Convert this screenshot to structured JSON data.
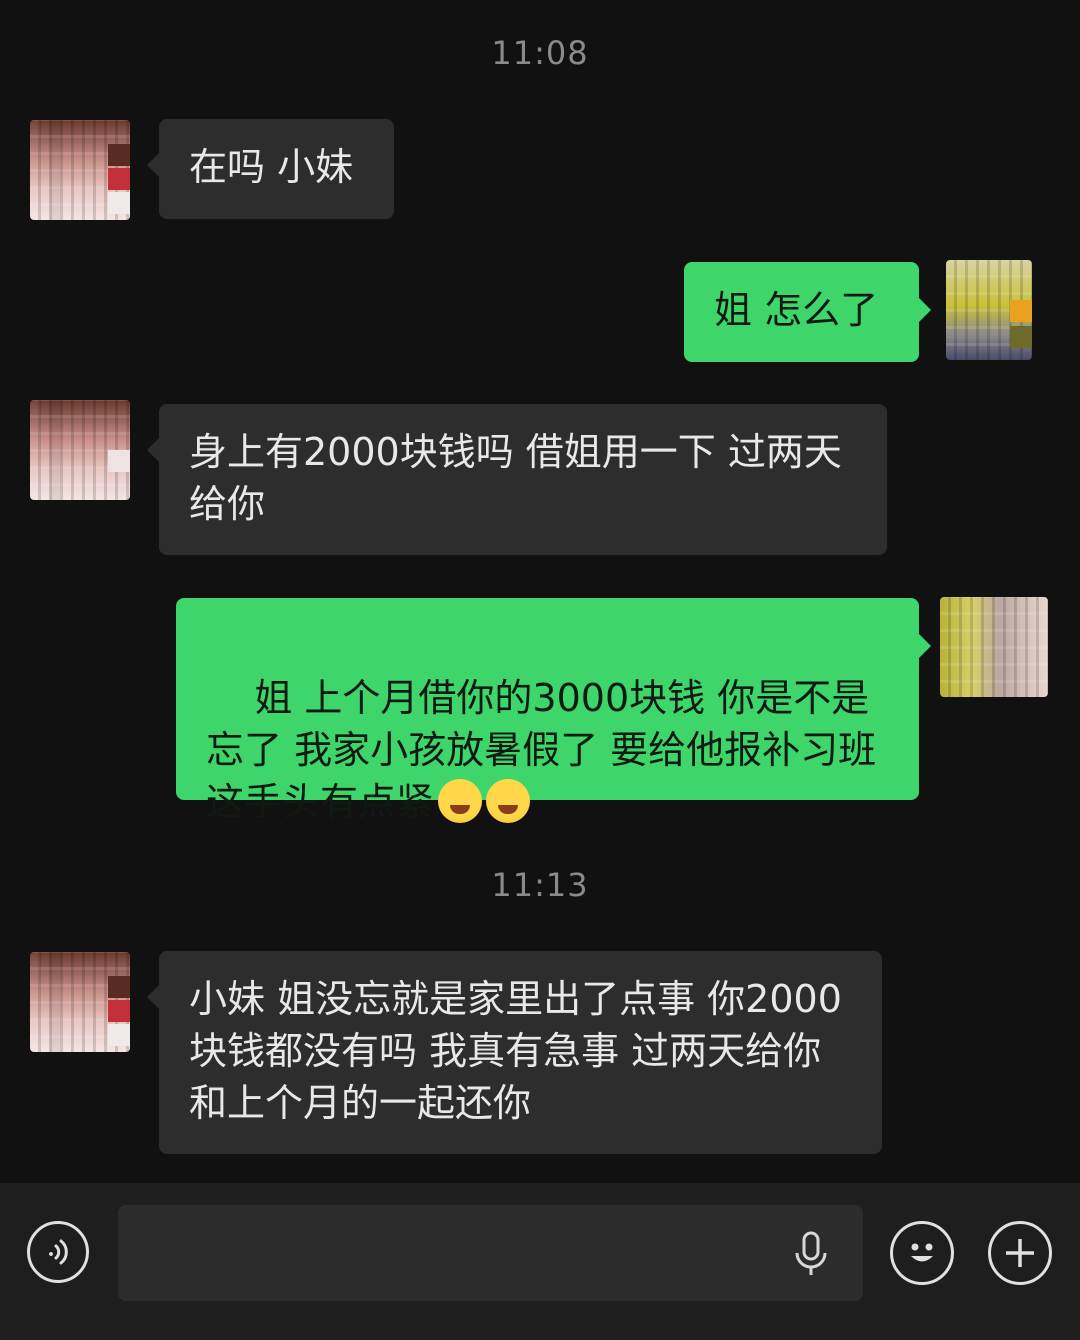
{
  "messages": [
    {
      "type": "time",
      "text": "11:08"
    },
    {
      "type": "in",
      "text": "在吗 小妹"
    },
    {
      "type": "out",
      "text": "姐 怎么了"
    },
    {
      "type": "in",
      "text": "身上有2000块钱吗 借姐用一下 过两天给你"
    },
    {
      "type": "out",
      "text": "姐 上个月借你的3000块钱 你是不是忘了 我家小孩放暑假了 要给他报补习班 这手头有点紧",
      "emoji": [
        "face-with-tears-of-joy-icon",
        "face-with-tears-of-joy-icon"
      ]
    },
    {
      "type": "time",
      "text": "11:13"
    },
    {
      "type": "in",
      "text": "小妹 姐没忘就是家里出了点事 你2000块钱都没有吗 我真有急事 过两天给你 和上个月的一起还你"
    }
  ],
  "input_bar": {
    "voice_icon": "voice-toggle-icon",
    "mic_icon": "microphone-icon",
    "emoji_icon": "emoji-smiley-icon",
    "plus_icon": "plus-icon"
  },
  "colors": {
    "background": "#111111",
    "incoming_bubble": "#2d2d2d",
    "outgoing_bubble": "#3ed66b",
    "timestamp": "#8a8a8a",
    "input_bar": "#1e1e1e"
  }
}
